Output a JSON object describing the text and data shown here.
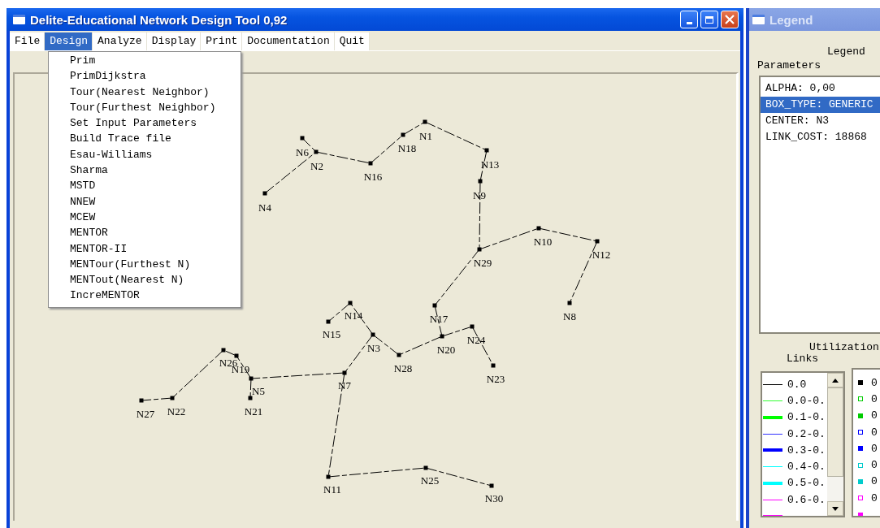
{
  "window": {
    "title": "Delite-Educational Network Design Tool 0,92"
  },
  "menubar": [
    {
      "label": "File",
      "selected": false
    },
    {
      "label": "Design",
      "selected": true
    },
    {
      "label": "Analyze",
      "selected": false
    },
    {
      "label": "Display",
      "selected": false
    },
    {
      "label": "Print",
      "selected": false
    },
    {
      "label": "Documentation",
      "selected": false
    },
    {
      "label": "Quit",
      "selected": false
    }
  ],
  "design_menu": [
    {
      "label": "Prim"
    },
    {
      "label": "PrimDijkstra"
    },
    {
      "label": "Tour(Nearest Neighbor)"
    },
    {
      "label": "Tour(Furthest Neighbor)"
    },
    {
      "label": "Set Input Parameters"
    },
    {
      "label": "Build Trace file"
    },
    {
      "label": "Esau-Williams"
    },
    {
      "label": "Sharma"
    },
    {
      "label": "MSTD"
    },
    {
      "label": "NNEW"
    },
    {
      "label": "MCEW"
    },
    {
      "label": "MENTOR"
    },
    {
      "label": "MENTOR-II"
    },
    {
      "label": "MENTour(Furthest N)"
    },
    {
      "label": "MENTout(Nearest N)"
    },
    {
      "label": "IncreMENTOR"
    }
  ],
  "network": {
    "nodes": [
      {
        "label": "N1"
      },
      {
        "label": "N6"
      },
      {
        "label": "N18"
      },
      {
        "label": "N2"
      },
      {
        "label": "N13"
      },
      {
        "label": "N16"
      },
      {
        "label": "N9"
      },
      {
        "label": "N4"
      },
      {
        "label": "N10"
      },
      {
        "label": "N29"
      },
      {
        "label": "N12"
      },
      {
        "label": "N14"
      },
      {
        "label": "N17"
      },
      {
        "label": "N8"
      },
      {
        "label": "N15"
      },
      {
        "label": "N24"
      },
      {
        "label": "N3"
      },
      {
        "label": "N20"
      },
      {
        "label": "N26"
      },
      {
        "label": "N19"
      },
      {
        "label": "N28"
      },
      {
        "label": "N23"
      },
      {
        "label": "N5"
      },
      {
        "label": "N7"
      },
      {
        "label": "N27"
      },
      {
        "label": "N22"
      },
      {
        "label": "N21"
      },
      {
        "label": "N11"
      },
      {
        "label": "N25"
      },
      {
        "label": "N30"
      }
    ]
  },
  "legend_window": {
    "title": "Legend",
    "heading": "Legend",
    "parameters_label": "Parameters",
    "parameters": [
      {
        "label": "ALPHA: 0,00",
        "selected": false
      },
      {
        "label": "BOX_TYPE: GENERIC",
        "selected": true
      },
      {
        "label": "CENTER: N3",
        "selected": false
      },
      {
        "label": "LINK_COST: 18868",
        "selected": false
      }
    ],
    "utilization_label": "Utilization",
    "links_label": "Links",
    "links": [
      {
        "label": "0.0",
        "color": "#000000",
        "kind": "thin"
      },
      {
        "label": "0.0-0.",
        "color": "#33ff33",
        "kind": "thin"
      },
      {
        "label": "0.1-0.",
        "color": "#00ff00",
        "kind": "thick"
      },
      {
        "label": "0.2-0.",
        "color": "#3333ff",
        "kind": "thin"
      },
      {
        "label": "0.3-0.",
        "color": "#0000ff",
        "kind": "thick"
      },
      {
        "label": "0.4-0.",
        "color": "#00ffff",
        "kind": "thin"
      },
      {
        "label": "0.5-0.",
        "color": "#00ffff",
        "kind": "thick"
      },
      {
        "label": "0.6-0.",
        "color": "#ff00ff",
        "kind": "thin"
      },
      {
        "color": "#ff00ff",
        "kind": "thick"
      }
    ],
    "nodes": [
      {
        "label": "0",
        "color": "#000000",
        "kind": "filled"
      },
      {
        "label": "0",
        "color": "#00cc00",
        "kind": "hollow"
      },
      {
        "label": "0",
        "color": "#00cc00",
        "kind": "filled"
      },
      {
        "label": "0",
        "color": "#0000ff",
        "kind": "hollow"
      },
      {
        "label": "0",
        "color": "#0000ff",
        "kind": "filled"
      },
      {
        "label": "0",
        "color": "#00cccc",
        "kind": "hollow"
      },
      {
        "label": "0",
        "color": "#00cccc",
        "kind": "filled"
      },
      {
        "label": "0",
        "color": "#ff00ff",
        "kind": "hollow"
      },
      {
        "color": "#ff00ff",
        "kind": "filled"
      }
    ]
  }
}
